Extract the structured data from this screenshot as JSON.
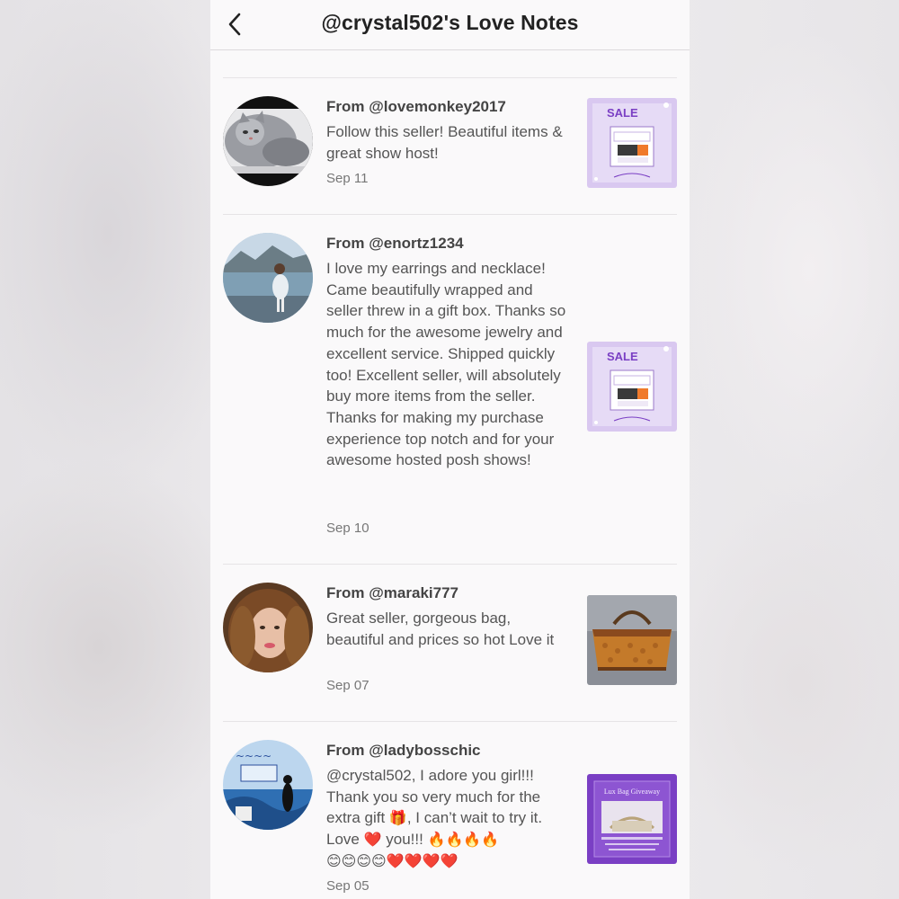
{
  "header": {
    "title": "@crystal502's Love Notes",
    "back_icon": "chevron-left-icon"
  },
  "notes": [
    {
      "from": "From @lovemonkey2017",
      "message": "Follow this seller! Beautiful items & great show host!",
      "date": "Sep 11",
      "thumb": {
        "sale": "SALE"
      }
    },
    {
      "from": "From @enortz1234",
      "message": "I love my earrings and necklace! Came beautifully wrapped and seller threw in a gift box. Thanks so much for the awesome jewelry and excellent service. Shipped quickly too! Excellent seller, will absolutely buy more items from the seller. Thanks for making my purchase experience top notch and for your awesome hosted posh shows!",
      "date": "Sep 10",
      "thumb": {
        "sale": "SALE"
      }
    },
    {
      "from": "From @maraki777",
      "message": "Great seller, gorgeous bag, beautiful and prices so hot Love it",
      "date": "Sep 07"
    },
    {
      "from": "From @ladybosschic",
      "message_parts": {
        "p1": "@crystal502, I adore you girl!!! Thank you so very much for the extra gift ",
        "gift": "🎁",
        "p2": ", I can’t wait to try it. Love ",
        "heart": "❤️",
        "p3": " you!!! ",
        "fire": "🔥🔥🔥🔥",
        "tail": "😊😊😊😊❤️❤️❤️❤️"
      },
      "date": "Sep 05",
      "thumb": {
        "title": "Lux Bag Giveaway"
      }
    }
  ],
  "colors": {
    "background": "#faf9fa",
    "text_primary": "#222222",
    "text_body": "#555555",
    "promo_purple": "#7a3fc4"
  }
}
